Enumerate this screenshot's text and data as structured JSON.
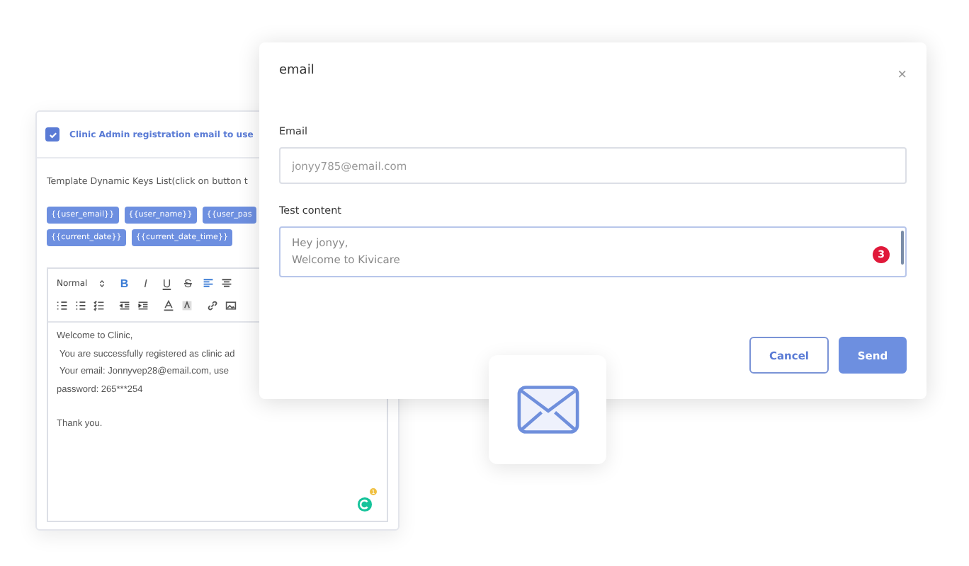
{
  "back_card": {
    "template": {
      "label": "Clinic Admin registration email to use",
      "checked": true
    },
    "keys_hint": "Template Dynamic Keys List(click on button t",
    "keys": [
      "{{user_email}}",
      "{{user_name}}",
      "{{user_pas",
      "{{current_date}}",
      "{{current_date_time}}"
    ],
    "editor": {
      "format": "Normal",
      "toolbar": [
        "B",
        "I",
        "U",
        "S"
      ],
      "lines": [
        "Welcome to Clinic,",
        "You are successfully registered as clinic ad",
        "Your email:  Jonnyvep28@email.com,  use",
        "password: 265***254"
      ],
      "closing": "Thank you.",
      "badge": "1"
    }
  },
  "dialog": {
    "title": "email",
    "close": "×",
    "email": {
      "label": "Email",
      "placeholder": "jonyy785@email.com"
    },
    "content": {
      "label": "Test content",
      "lines": [
        "Hey jonyy,",
        "Welcome to Kivicare"
      ],
      "badge": "3"
    },
    "buttons": [
      {
        "label": "Cancel",
        "kind": "secondary"
      },
      {
        "label": "Send",
        "kind": "primary"
      }
    ]
  }
}
